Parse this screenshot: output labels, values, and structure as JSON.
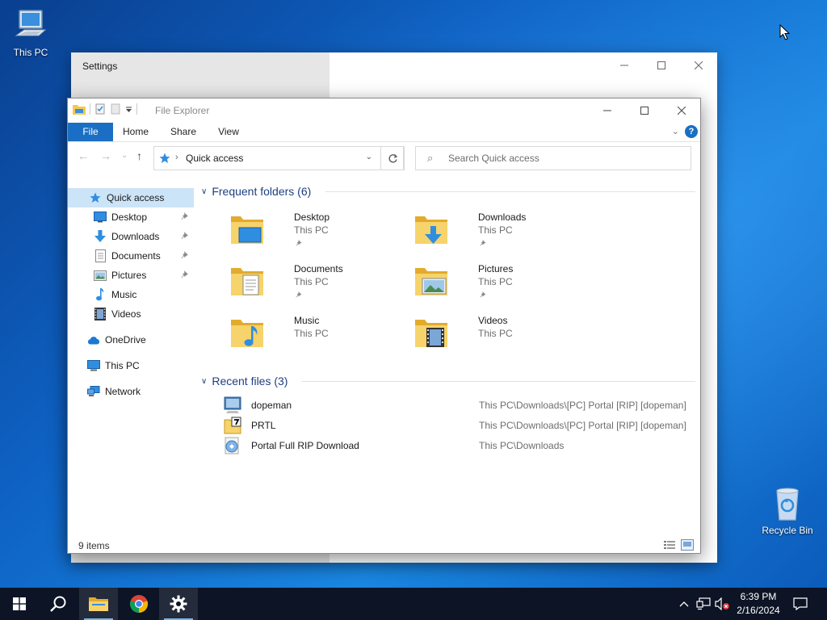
{
  "desktop": {
    "icons": [
      {
        "label": "This PC"
      },
      {
        "label": "Recycle Bin"
      }
    ]
  },
  "settings_window": {
    "title": "Settings",
    "peek_text": "        "
  },
  "explorer": {
    "title": "File Explorer",
    "ribbon": {
      "tabs": [
        {
          "label": "File"
        },
        {
          "label": "Home"
        },
        {
          "label": "Share"
        },
        {
          "label": "View"
        }
      ],
      "help": "?"
    },
    "address": {
      "location": "Quick access"
    },
    "search": {
      "placeholder": "Search Quick access"
    },
    "nav": [
      {
        "label": "Quick access",
        "icon": "star-icon",
        "pinned": false,
        "selected": true
      },
      {
        "label": "Desktop",
        "icon": "desktop-icon",
        "pinned": true
      },
      {
        "label": "Downloads",
        "icon": "download-icon",
        "pinned": true
      },
      {
        "label": "Documents",
        "icon": "document-icon",
        "pinned": true
      },
      {
        "label": "Pictures",
        "icon": "picture-icon",
        "pinned": true
      },
      {
        "label": "Music",
        "icon": "music-icon",
        "pinned": false
      },
      {
        "label": "Videos",
        "icon": "video-icon",
        "pinned": false
      },
      {
        "label": "OneDrive",
        "icon": "cloud-icon",
        "pinned": false
      },
      {
        "label": "This PC",
        "icon": "computer-icon",
        "pinned": false
      },
      {
        "label": "Network",
        "icon": "network-icon",
        "pinned": false
      }
    ],
    "frequent": {
      "header": "Frequent folders (6)",
      "folders": [
        {
          "name": "Desktop",
          "location": "This PC",
          "pinned": true
        },
        {
          "name": "Downloads",
          "location": "This PC",
          "pinned": true
        },
        {
          "name": "Documents",
          "location": "This PC",
          "pinned": true
        },
        {
          "name": "Pictures",
          "location": "This PC",
          "pinned": true
        },
        {
          "name": "Music",
          "location": "This PC",
          "pinned": false
        },
        {
          "name": "Videos",
          "location": "This PC",
          "pinned": false
        }
      ]
    },
    "recent": {
      "header": "Recent files (3)",
      "files": [
        {
          "name": "dopeman",
          "path": "This PC\\Downloads\\[PC] Portal [RIP] [dopeman]"
        },
        {
          "name": "PRTL",
          "path": "This PC\\Downloads\\[PC] Portal [RIP] [dopeman]"
        },
        {
          "name": "Portal Full RIP Download",
          "path": "This PC\\Downloads"
        }
      ]
    },
    "status": {
      "item_count": "9 items"
    }
  },
  "taskbar": {
    "clock": {
      "time": "6:39 PM",
      "date": "2/16/2024"
    }
  },
  "colors": {
    "accent": "#1a6fc4",
    "selection": "#cce4f7",
    "taskbar": "#0c1425",
    "folder": "#f3c94f"
  }
}
